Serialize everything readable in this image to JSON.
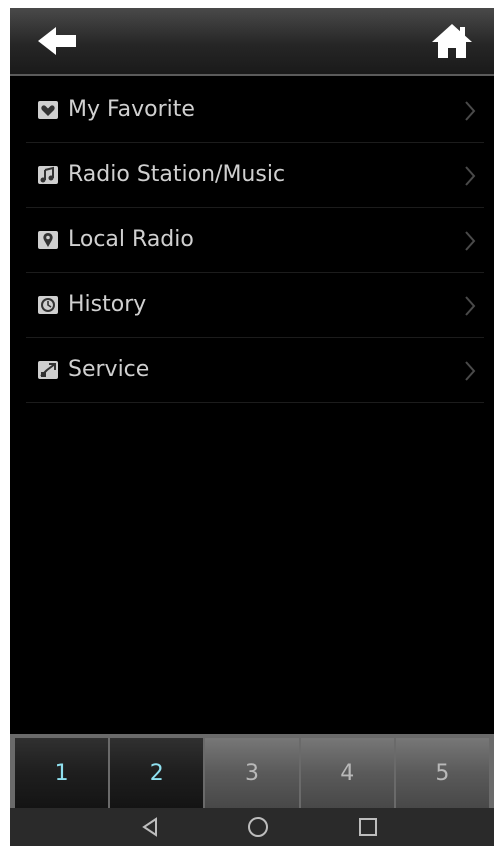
{
  "menu": {
    "items": [
      {
        "label": "My Favorite",
        "icon": "heart-icon"
      },
      {
        "label": "Radio Station/Music",
        "icon": "music-note-icon"
      },
      {
        "label": "Local Radio",
        "icon": "location-pin-icon"
      },
      {
        "label": "History",
        "icon": "clock-icon"
      },
      {
        "label": "Service",
        "icon": "service-icon"
      }
    ]
  },
  "pager": {
    "pages": [
      "1",
      "2",
      "3",
      "4",
      "5"
    ],
    "active_pages": [
      "1",
      "2"
    ]
  },
  "colors": {
    "background": "#000000",
    "text": "#d0d0d0",
    "active_page_text": "#8fe0ef"
  }
}
